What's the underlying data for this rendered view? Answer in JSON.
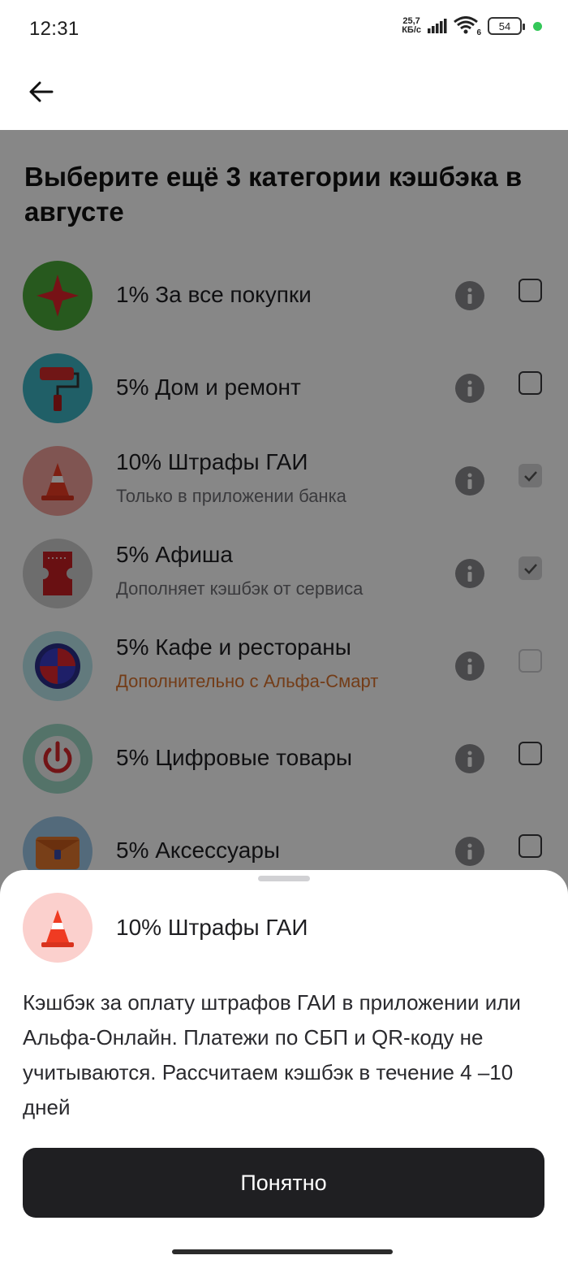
{
  "status_bar": {
    "time": "12:31",
    "speed_value": "25,7",
    "speed_unit": "КБ/с",
    "wifi_badge": "6",
    "battery": "54"
  },
  "header": {
    "back_icon": "arrow-left-icon",
    "title": "Выберите ещё 3 категории кэшбэка в августе"
  },
  "categories": [
    {
      "title": "1% За все покупки",
      "subtitle": "",
      "icon": "star-icon",
      "icon_bg": "#4aa83a",
      "checked": false
    },
    {
      "title": "5% Дом и ремонт",
      "subtitle": "",
      "icon": "paint-roller-icon",
      "icon_bg": "#3db3c2",
      "checked": false
    },
    {
      "title": "10% Штрафы ГАИ",
      "subtitle": "Только в приложении банка",
      "icon": "traffic-cone-icon",
      "icon_bg": "#f2a19b",
      "checked": true
    },
    {
      "title": "5% Афиша",
      "subtitle": "Дополняет кэшбэк от сервиса",
      "icon": "ticket-icon",
      "icon_bg": "#cfcfcf",
      "checked": true
    },
    {
      "title": "5% Кафе и рестораны",
      "subtitle": "Дополнительно с Альфа-Смарт",
      "icon": "plate-icon",
      "icon_bg": "#b9e6ec",
      "checked": false,
      "disabled": true
    },
    {
      "title": "5% Цифровые товары",
      "subtitle": "",
      "icon": "power-icon",
      "icon_bg": "#9fd9c6",
      "checked": false
    },
    {
      "title": "5% Аксессуары",
      "subtitle": "",
      "icon": "bag-icon",
      "icon_bg": "#9ec9e8",
      "checked": false
    }
  ],
  "sheet": {
    "title": "10% Штрафы ГАИ",
    "description": "Кэшбэк за оплату штрафов ГАИ в приложении или Альфа-Онлайн. Платежи по СБП и QR-коду не учитываются. Рассчитаем кэшбэк в течение 4 –10 дней",
    "button_label": "Понятно",
    "icon": "traffic-cone-icon"
  },
  "colors": {
    "accent_orange": "#d9722d",
    "button_dark": "#1f1f22",
    "overlay": "rgba(0,0,0,0.47)"
  }
}
